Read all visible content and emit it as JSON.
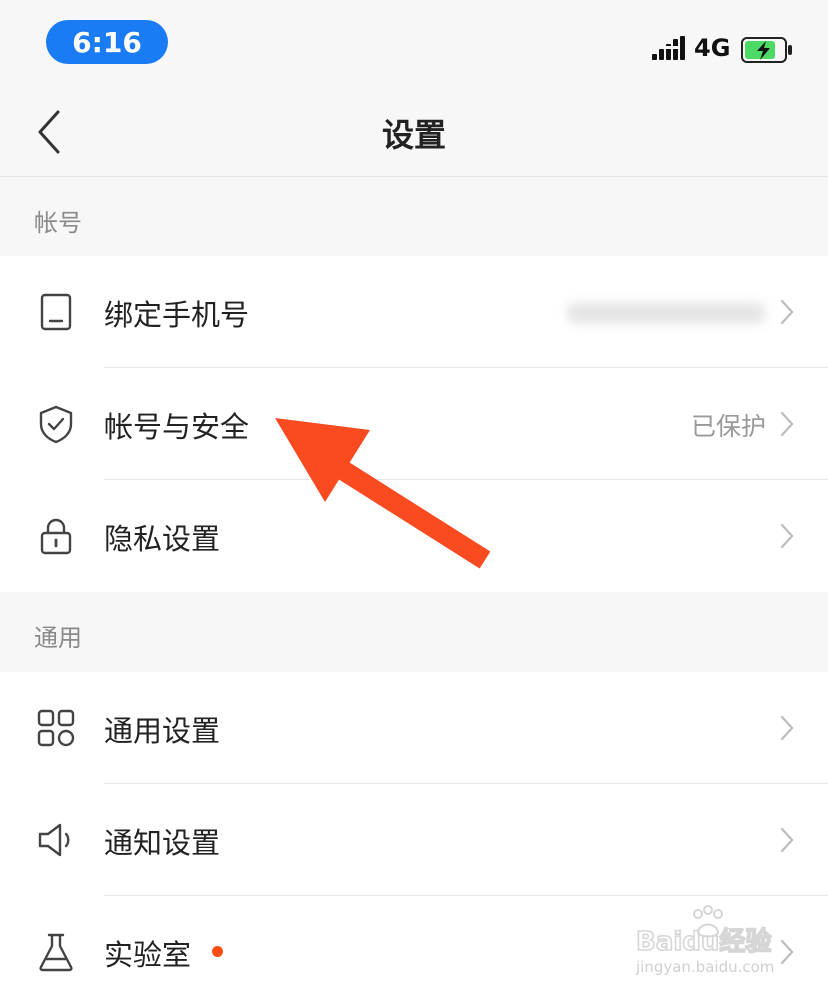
{
  "status_bar": {
    "time": "6:16",
    "network": "4G",
    "signal_icon": "signal-bars-icon",
    "battery_icon": "battery-charging-icon",
    "battery_color": "#4cd964"
  },
  "nav": {
    "title": "设置",
    "back_icon": "chevron-left-icon"
  },
  "sections": [
    {
      "header": "帐号",
      "items": [
        {
          "label": "绑定手机号",
          "icon": "phone-icon",
          "value_blurred": true
        },
        {
          "label": "帐号与安全",
          "icon": "shield-check-icon",
          "value": "已保护"
        },
        {
          "label": "隐私设置",
          "icon": "lock-icon"
        }
      ]
    },
    {
      "header": "通用",
      "items": [
        {
          "label": "通用设置",
          "icon": "grid-icon"
        },
        {
          "label": "通知设置",
          "icon": "speaker-icon"
        },
        {
          "label": "实验室",
          "icon": "flask-icon",
          "badge_dot": true
        }
      ]
    }
  ],
  "annotation": {
    "arrow_color": "#fa4a20"
  },
  "watermark": {
    "logo_text": "Baidu经验",
    "url": "jingyan.baidu.com"
  },
  "colors": {
    "accent": "#1a7cf5",
    "badge": "#ff4d14"
  }
}
